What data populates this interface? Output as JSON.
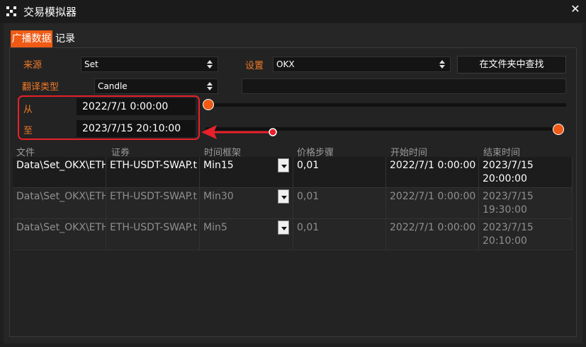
{
  "window": {
    "title": "交易模拟器",
    "close_label": "✕"
  },
  "tabs": [
    {
      "label": "广播数据",
      "active": true
    },
    {
      "label": "记录",
      "active": false
    }
  ],
  "form": {
    "source": {
      "label": "来源",
      "value": "Set"
    },
    "settings": {
      "label": "设置",
      "value": "OKX"
    },
    "find_in_folder": {
      "label": "在文件夹中查找"
    },
    "translate_type": {
      "label": "翻译类型",
      "value": "Candle"
    },
    "from": {
      "label": "从",
      "value": "2022/7/1 0:00:00"
    },
    "to": {
      "label": "至",
      "value": "2023/7/15 20:10:00"
    }
  },
  "sliders": {
    "from_level": 0.0,
    "to_level": 1.0
  },
  "table": {
    "columns": [
      "文件",
      "证券",
      "时间框架",
      "价格步骤",
      "开始时间",
      "结束时间"
    ],
    "rows": [
      {
        "file": "Data\\Set_OKX\\ETH",
        "security": "ETH-USDT-SWAP.t",
        "timeframe": "Min15",
        "price_step": "0,01",
        "start": "2022/7/1 0:00:00",
        "end_date": "2023/7/15",
        "end_time": "20:00:00",
        "active": true
      },
      {
        "file": "Data\\Set_OKX\\ETH",
        "security": "ETH-USDT-SWAP.t",
        "timeframe": "Min30",
        "price_step": "0,01",
        "start": "2022/7/1 0:00:00",
        "end_date": "2023/7/15",
        "end_time": "19:30:00",
        "active": false
      },
      {
        "file": "Data\\Set_OKX\\ETH",
        "security": "ETH-USDT-SWAP.t",
        "timeframe": "Min5",
        "price_step": "0,01",
        "start": "2022/7/1 0:00:00",
        "end_date": "2023/7/15",
        "end_time": "20:10:00",
        "active": false
      }
    ]
  },
  "colors": {
    "accent": "#f05a14",
    "label": "#f07a28",
    "highlight": "#e8202a"
  },
  "icons": {
    "app": "app-logo-icon",
    "close": "close-icon",
    "spinner": "up-down-arrows-icon",
    "dropdown": "chevron-down-icon"
  }
}
